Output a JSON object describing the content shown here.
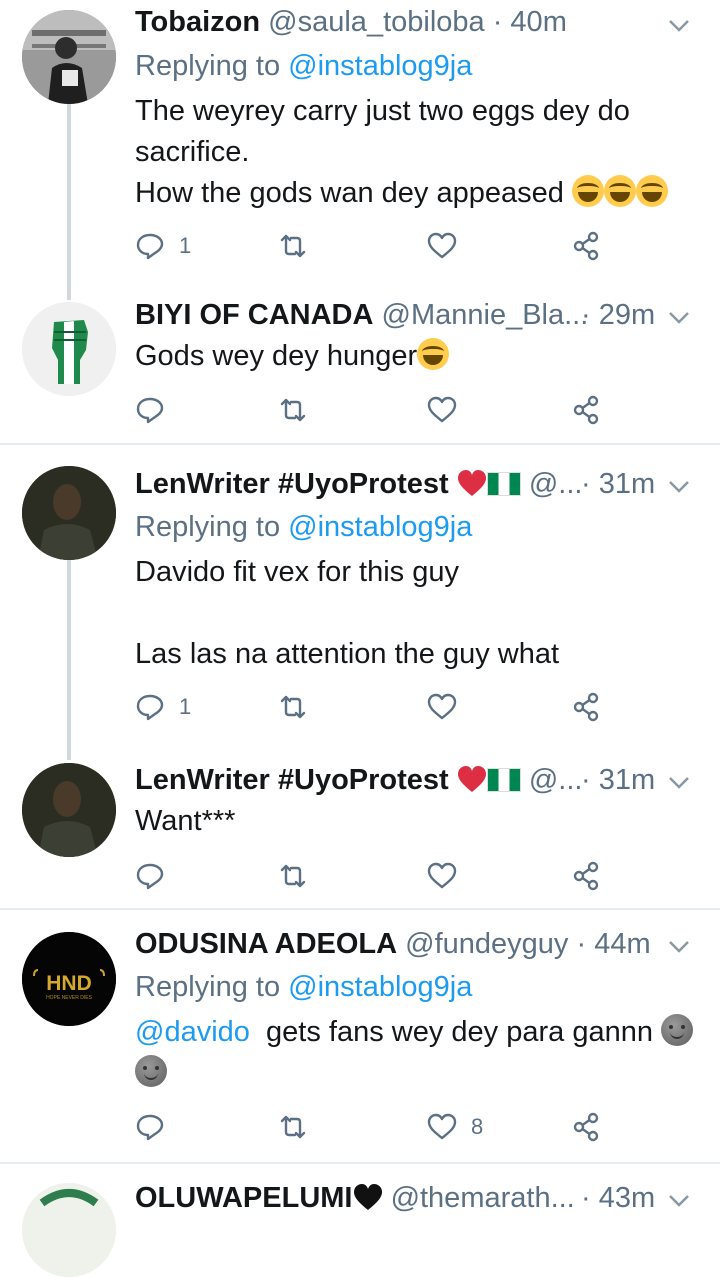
{
  "tweets": [
    {
      "name": "Tobaizon",
      "handle": "@saula_tobiloba",
      "time": "· 40m",
      "replying_prefix": "Replying to",
      "replying_to": "@instablog9ja",
      "lines": [
        "The weyrey carry just two eggs dey do",
        "sacrifice.",
        "How the gods wan dey appeased"
      ],
      "reply_count": "1",
      "like_count": ""
    },
    {
      "name": "BIYI OF CANADA",
      "handle": "@Mannie_Bla...",
      "time": "· 29m",
      "lines": [
        "Gods wey dey hunger"
      ],
      "reply_count": "",
      "like_count": ""
    },
    {
      "name": "LenWriter #UyoProtest",
      "handle": "@...",
      "time": "· 31m",
      "replying_prefix": "Replying to",
      "replying_to": "@instablog9ja",
      "lines": [
        "Davido fit vex for this guy",
        "Las las na attention the guy what"
      ],
      "reply_count": "1",
      "like_count": ""
    },
    {
      "name": "LenWriter #UyoProtest",
      "handle": "@...",
      "time": "· 31m",
      "lines": [
        "Want***"
      ],
      "reply_count": "",
      "like_count": ""
    },
    {
      "name": "ODUSINA ADEOLA",
      "handle": "@fundeyguy",
      "time": "· 44m",
      "replying_prefix": "Replying to",
      "replying_to": "@instablog9ja",
      "mention": "@davido",
      "lines": [
        "gets fans wey dey para gannn"
      ],
      "reply_count": "",
      "like_count": "8",
      "avatar_text": "HND",
      "avatar_subtext": "HOPE NEVER DIES"
    },
    {
      "name": "OLUWAPELUMI",
      "handle": "@themarath...",
      "time": "· 43m"
    }
  ],
  "icons": {
    "reply": "reply-icon",
    "retweet": "retweet-icon",
    "like": "heart-icon",
    "share": "share-icon",
    "more": "chevron-down-icon"
  },
  "colors": {
    "link": "#1d9bf0",
    "secondary": "#5b7083",
    "divider": "#e6ecf0",
    "thread_line": "#cfd9de"
  }
}
